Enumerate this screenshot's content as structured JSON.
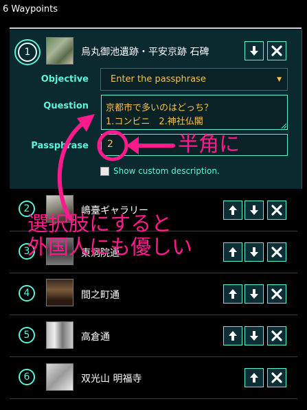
{
  "header": {
    "title": "6 Waypoints"
  },
  "colors": {
    "accent": "#5af5d8",
    "annotation": "#ff1a8c",
    "field_text": "#f5c14a"
  },
  "waypoints": [
    {
      "num": "1",
      "name": "烏丸御池遺跡・平安京跡 石碑",
      "expanded": true,
      "buttons": [
        "move-down",
        "remove"
      ]
    },
    {
      "num": "2",
      "name": "嶋臺ギャラリー",
      "buttons": [
        "move-up",
        "move-down",
        "remove"
      ]
    },
    {
      "num": "3",
      "name": "東洞院通",
      "buttons": [
        "move-up",
        "move-down",
        "remove"
      ]
    },
    {
      "num": "4",
      "name": "間之町通",
      "buttons": [
        "move-up",
        "move-down",
        "remove"
      ]
    },
    {
      "num": "5",
      "name": "高倉通",
      "buttons": [
        "move-up",
        "move-down",
        "remove"
      ]
    },
    {
      "num": "6",
      "name": "双光山 明福寺",
      "buttons": [
        "move-up",
        "remove"
      ]
    }
  ],
  "editor": {
    "objective_label": "Objective",
    "objective_value": "Enter the passphrase",
    "question_label": "Question",
    "question_line1": "京都市で多いのはどっち？",
    "question_line2": "1.コンビニ　2.神社仏閣",
    "passphrase_label": "Passphrase",
    "passphrase_value": "2",
    "custom_desc_label": "Show custom description.",
    "custom_desc_checked": false
  },
  "annotations": {
    "halfwidth": "半角に",
    "choices_line1": "選択肢にすると",
    "choices_line2": "外国人にも優しい"
  }
}
